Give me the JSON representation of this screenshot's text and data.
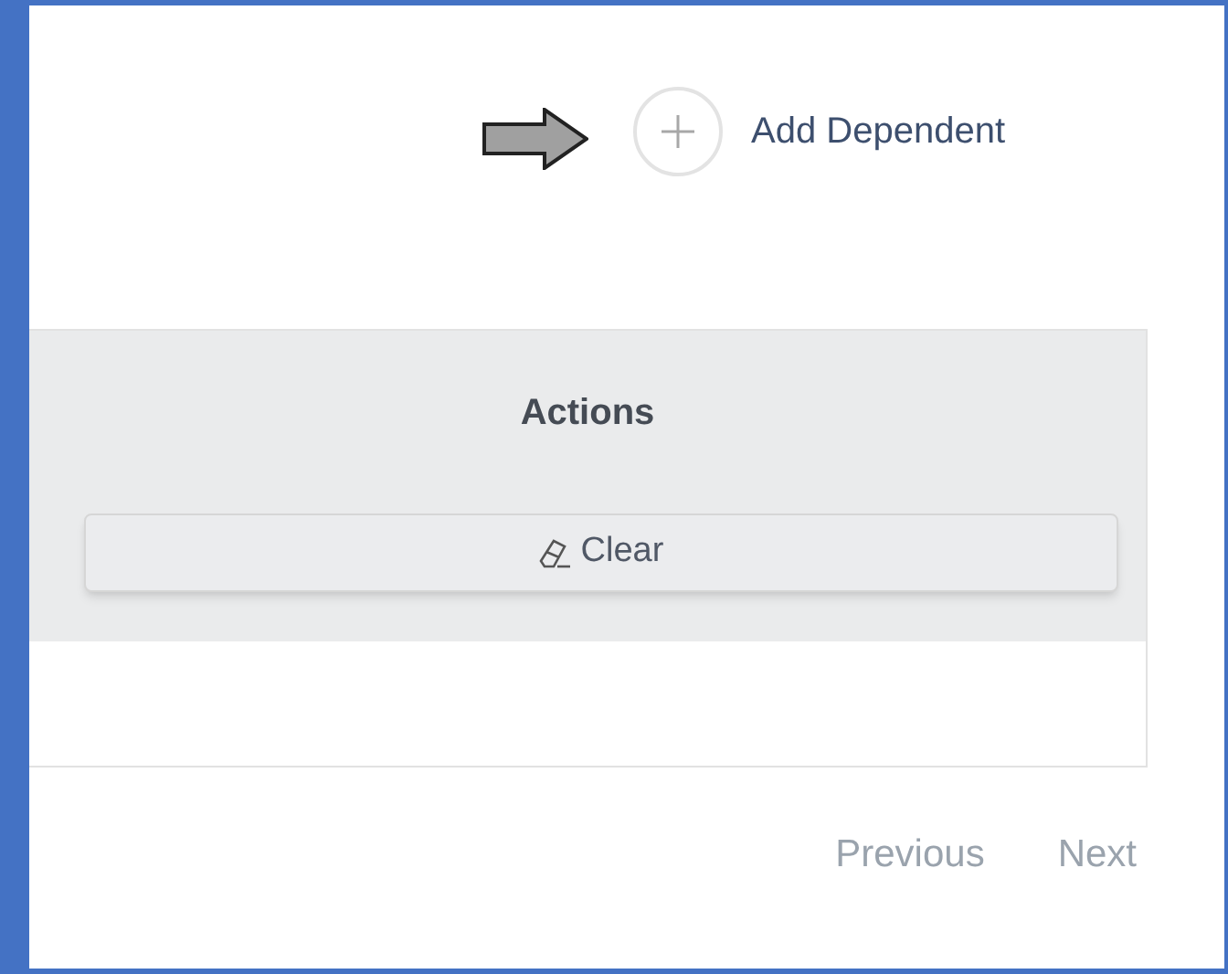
{
  "add_button": {
    "label": "Add Dependent"
  },
  "table": {
    "columns": [
      {
        "label": "Actions"
      }
    ],
    "filter_row": {
      "clear_button": {
        "label": "Clear"
      }
    }
  },
  "pagination": [
    {
      "label": "Previous",
      "disabled": true
    },
    {
      "label": "Next",
      "disabled": true
    }
  ]
}
